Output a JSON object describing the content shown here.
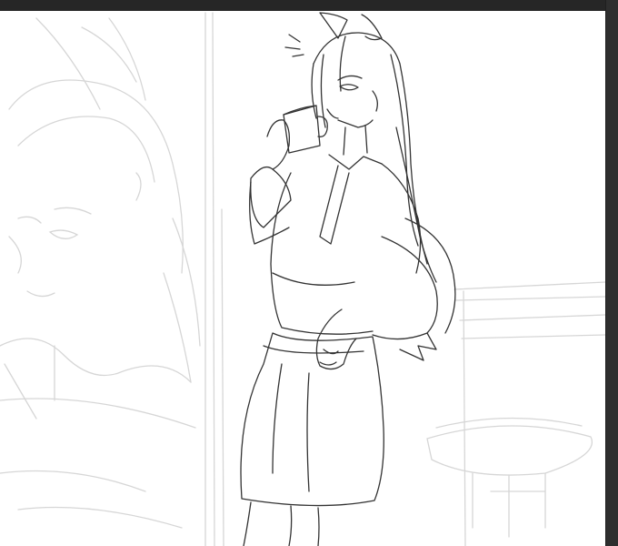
{
  "window": {
    "background_color": "#2b2b2b",
    "canvas_color": "#ffffff"
  },
  "artwork": {
    "icon": "sketch-artwork",
    "line_color": "#333333",
    "guide_color": "#d6d6d6"
  }
}
